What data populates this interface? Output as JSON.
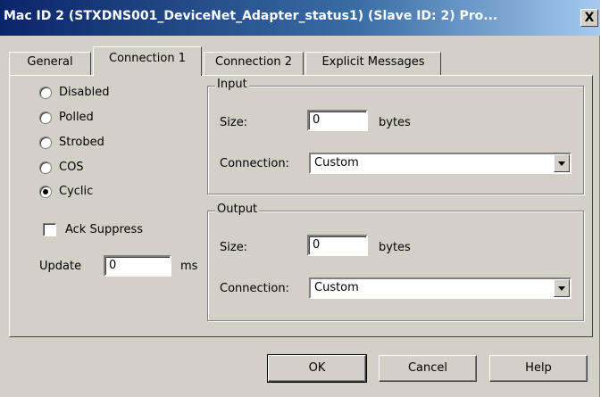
{
  "window": {
    "title": "Mac ID 2 (STXDNS001_DeviceNet_Adapter_status1) (Slave ID: 2) Pro...",
    "close_label": "X"
  },
  "tabs": [
    {
      "label": "General",
      "active": false
    },
    {
      "label": "Connection 1",
      "active": true
    },
    {
      "label": "Connection 2",
      "active": false
    },
    {
      "label": "Explicit Messages",
      "active": false
    }
  ],
  "connection_type": {
    "options": [
      "Disabled",
      "Polled",
      "Strobed",
      "COS",
      "Cyclic"
    ],
    "selected": "Cyclic"
  },
  "ack_suppress": {
    "label": "Ack Suppress",
    "checked": false
  },
  "update": {
    "label": "Update",
    "value": "0",
    "unit": "ms"
  },
  "input": {
    "title": "Input",
    "size_label": "Size:",
    "size_value": "0",
    "size_unit": "bytes",
    "connection_label": "Connection:",
    "connection_value": "Custom"
  },
  "output": {
    "title": "Output",
    "size_label": "Size:",
    "size_value": "0",
    "size_unit": "bytes",
    "connection_label": "Connection:",
    "connection_value": "Custom"
  },
  "buttons": {
    "ok": "OK",
    "cancel": "Cancel",
    "help": "Help"
  }
}
